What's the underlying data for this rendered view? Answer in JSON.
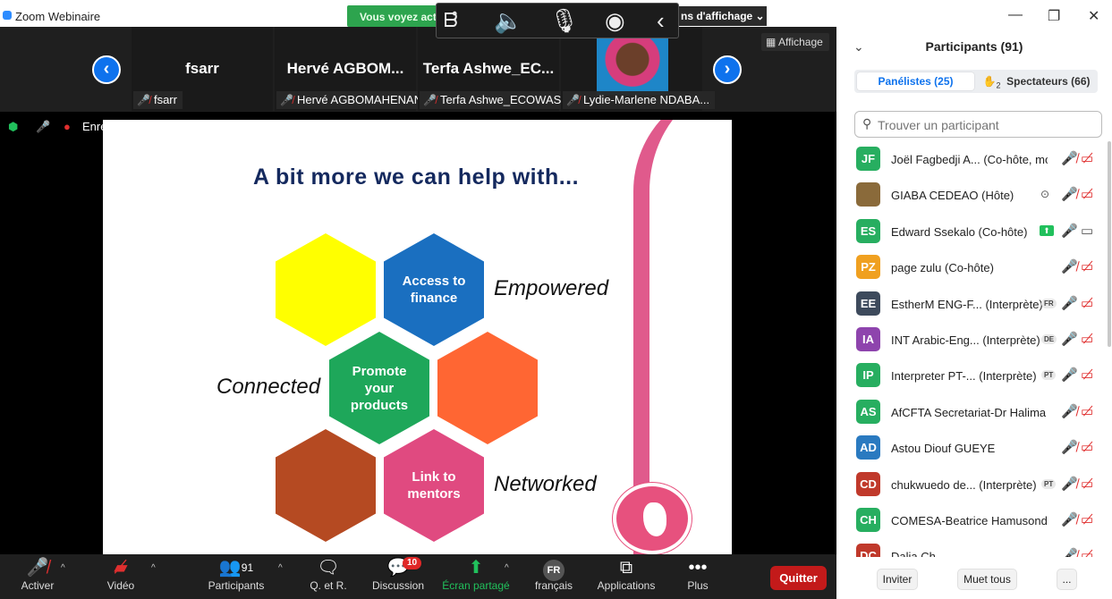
{
  "window": {
    "title": "Zoom Webinaire"
  },
  "share_banner": {
    "text": "Vous voyez act"
  },
  "view_options": {
    "label": "ns d'affichage ⌄"
  },
  "affichage": {
    "label": "Affichage"
  },
  "video_strip": {
    "tiles": [
      {
        "name": "fsarr",
        "label": "fsarr"
      },
      {
        "name": "Hervé  AGBOM...",
        "label": "Hervé AGBOMAHENAN"
      },
      {
        "name": "Terfa  Ashwe_EC...",
        "label": "Terfa Ashwe_ECOWAS"
      },
      {
        "name": "",
        "label": "Lydie-Marlene NDABA..."
      }
    ]
  },
  "recording": {
    "label": "Enre"
  },
  "slide": {
    "title": "A bit more we can help with...",
    "hexes": [
      {
        "text": "",
        "color": "#ffff00"
      },
      {
        "text": "Access to finance",
        "color": "#1a6fc0"
      },
      {
        "text": "Promote your products",
        "color": "#1ea75a"
      },
      {
        "text": "",
        "color": "#ff6633"
      },
      {
        "text": "",
        "color": "#b54a22"
      },
      {
        "text": "Link to mentors",
        "color": "#e04a80"
      }
    ],
    "words": {
      "empowered": "Empowered",
      "connected": "Connected",
      "networked": "Networked"
    }
  },
  "toolbar": {
    "mute": "Activer",
    "video": "Vidéo",
    "participants": "Participants",
    "participants_count": "91",
    "qa": "Q. et R.",
    "chat": "Discussion",
    "chat_badge": "10",
    "share": "Écran partagé",
    "language_code": "FR",
    "language": "français",
    "apps": "Applications",
    "more": "Plus",
    "quit": "Quitter"
  },
  "panel": {
    "title": "Participants (91)",
    "tabs": {
      "panelists": "Panélistes (25)",
      "hands_count": "2",
      "attendees": "Spectateurs (66)"
    },
    "search_placeholder": "Trouver un participant",
    "participants": [
      {
        "initials": "JF",
        "color": "#27ae60",
        "name": "Joël Fagbedji A...  (Co-hôte, moi)",
        "lang": "",
        "mic": "muted",
        "video": "off",
        "extra": ""
      },
      {
        "initials": "",
        "color": "#8a6a3a",
        "name": "GIABA CEDEAO (Hôte)",
        "lang": "",
        "mic": "muted",
        "video": "off",
        "extra": "rec"
      },
      {
        "initials": "ES",
        "color": "#27ae60",
        "name": "Edward Ssekalo (Co-hôte)",
        "lang": "",
        "mic": "on",
        "video": "on",
        "extra": "share"
      },
      {
        "initials": "PZ",
        "color": "#f0a020",
        "name": "page zulu (Co-hôte)",
        "lang": "",
        "mic": "muted",
        "video": "off",
        "extra": ""
      },
      {
        "initials": "EE",
        "color": "#3d4a5c",
        "name": "EstherM ENG-F...  (Interprète)",
        "lang": "FR",
        "mic": "on",
        "video": "off",
        "extra": ""
      },
      {
        "initials": "IA",
        "color": "#8e44ad",
        "name": "INT Arabic-Eng...  (Interprète)",
        "lang": "DE",
        "mic": "on",
        "video": "off",
        "extra": ""
      },
      {
        "initials": "IP",
        "color": "#27ae60",
        "name": "Interpreter PT-...  (Interprète)",
        "lang": "PT",
        "mic": "on",
        "video": "off",
        "extra": ""
      },
      {
        "initials": "AS",
        "color": "#27ae60",
        "name": "AfCFTA Secretariat-Dr Halima ...",
        "lang": "",
        "mic": "muted",
        "video": "off",
        "extra": ""
      },
      {
        "initials": "AD",
        "color": "#2a7ac0",
        "name": "Astou Diouf GUEYE",
        "lang": "",
        "mic": "muted",
        "video": "off",
        "extra": ""
      },
      {
        "initials": "CD",
        "color": "#c0392b",
        "name": "chukwuedo de...  (Interprète)",
        "lang": "PT",
        "mic": "muted",
        "video": "off",
        "extra": ""
      },
      {
        "initials": "CH",
        "color": "#27ae60",
        "name": "COMESA-Beatrice Hamusonde",
        "lang": "",
        "mic": "muted",
        "video": "off",
        "extra": ""
      },
      {
        "initials": "DC",
        "color": "#c0392b",
        "name": "Dalia Ch...",
        "lang": "",
        "mic": "muted",
        "video": "off",
        "extra": ""
      }
    ],
    "buttons": {
      "invite": "Inviter",
      "mute_all": "Muet tous",
      "more": "..."
    }
  }
}
